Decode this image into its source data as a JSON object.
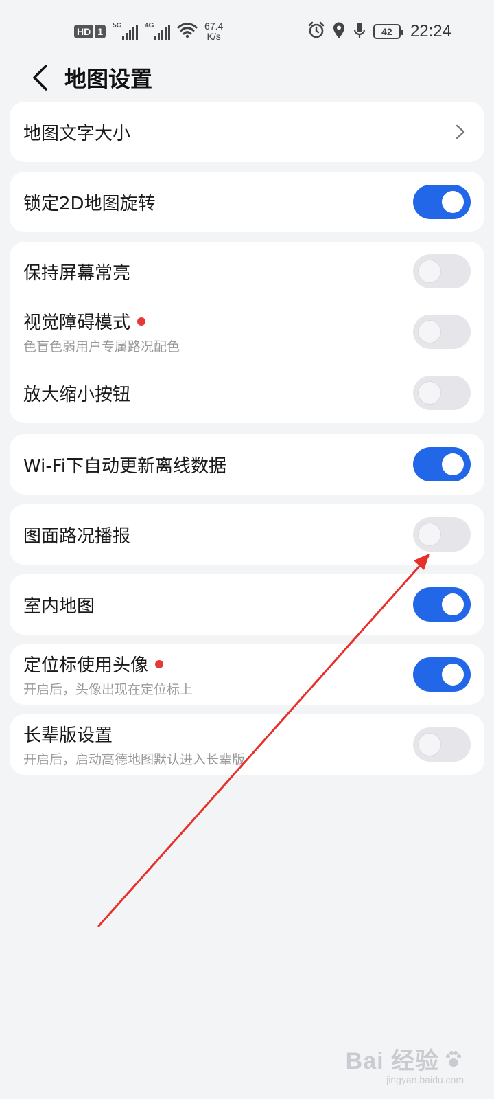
{
  "status_bar": {
    "hd_label": "HD",
    "sim_label": "1",
    "signal_1_label": "5G",
    "signal_2_label": "4G",
    "speed_value": "67.4",
    "speed_unit": "K/s",
    "battery_level": "42",
    "time": "22:24",
    "icons": [
      "alarm-icon",
      "location-icon",
      "microphone-icon"
    ]
  },
  "header": {
    "title": "地图设置",
    "back_icon": "chevron-left-icon"
  },
  "settings": {
    "map_text_size": {
      "label": "地图文字大小"
    },
    "lock_2d_rotation": {
      "label": "锁定2D地图旋转",
      "enabled": true
    },
    "keep_screen_on": {
      "label": "保持屏幕常亮",
      "enabled": false
    },
    "visual_impairment_mode": {
      "label": "视觉障碍模式",
      "sub": "色盲色弱用户专属路况配色",
      "enabled": false,
      "new_dot": true
    },
    "zoom_buttons": {
      "label": "放大缩小按钮",
      "enabled": false
    },
    "wifi_auto_update": {
      "label": "Wi-Fi下自动更新离线数据",
      "enabled": true
    },
    "traffic_broadcast": {
      "label": "图面路况播报",
      "enabled": false
    },
    "indoor_map": {
      "label": "室内地图",
      "enabled": true
    },
    "avatar_location_marker": {
      "label": "定位标使用头像",
      "sub": "开启后，头像出现在定位标上",
      "enabled": true,
      "new_dot": true
    },
    "elder_mode": {
      "label": "长辈版设置",
      "sub": "开启后，启动高德地图默认进入长辈版",
      "enabled": false
    }
  },
  "colors": {
    "toggle_on": "#2167e8",
    "toggle_off": "#e6e6ea",
    "dot": "#e53935",
    "annotation_arrow": "#e8302a"
  },
  "watermark": {
    "main": "Bai 经验",
    "sub": "jingyan.baidu.com"
  }
}
